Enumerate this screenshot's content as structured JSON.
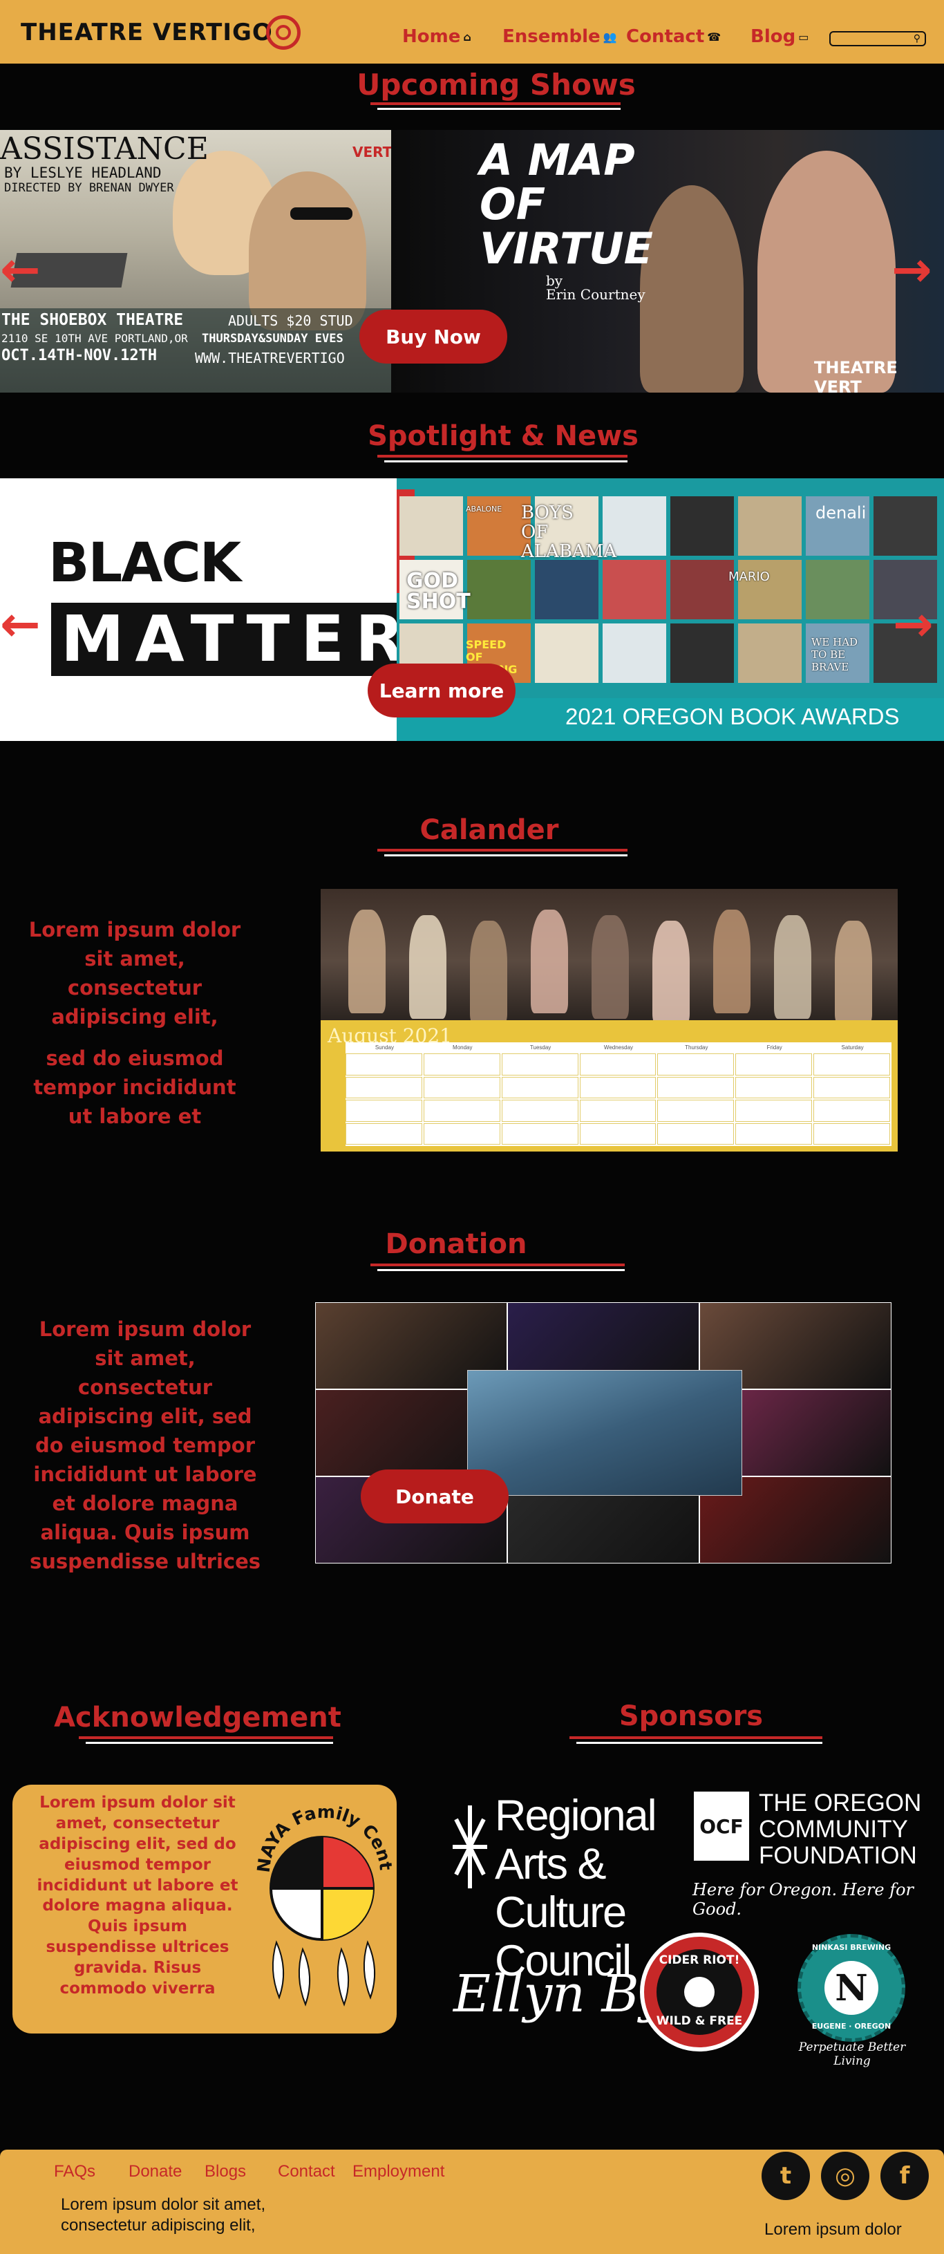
{
  "header": {
    "logo_text": "THEATRE VERTIGO",
    "nav": [
      {
        "label": "Home",
        "icon": "home-icon"
      },
      {
        "label": "Ensemble",
        "icon": "people-icon"
      },
      {
        "label": "Contact",
        "icon": "phone-icon"
      },
      {
        "label": "Blog",
        "icon": "laptop-icon"
      }
    ],
    "search": {
      "placeholder": ""
    }
  },
  "upcoming": {
    "title": "Upcoming Shows",
    "slide_left": {
      "title": "ASSISTANCE",
      "byline": "BY LESLYE HEADLAND",
      "director": "DIRECTED BY BRENAN DWYER",
      "venue": "THE SHOEBOX THEATRE",
      "prices": "ADULTS $20 STUD",
      "address": "2110 SE 10TH AVE PORTLAND,OR",
      "days": "THURSDAY&SUNDAY EVES",
      "dates": "OCT.14TH-NOV.12TH",
      "web": "WWW.THEATREVERTIGO",
      "corner": "VERTI"
    },
    "slide_right": {
      "title_line1": "A MAP",
      "title_line2": "OF",
      "title_line3": "VIRTUE",
      "by": "by",
      "author": "Erin Courtney",
      "brand": "THEATRE VERT"
    },
    "button": "Buy Now"
  },
  "spotlight": {
    "title": "Spotlight & News",
    "blm_line1": "BLACK LIVES",
    "blm_line2": "MATTER",
    "books_banner": "2021 OREGON BOOK AWARDS",
    "book_titles": [
      "ABALONE",
      "BOYS OF ALABAMA",
      "GOD SHOT",
      "SPEED OF FALLING",
      "MARIO",
      "denali",
      "WE HAD TO BE BRAVE"
    ],
    "button": "Learn more"
  },
  "calendar": {
    "title": "Calander",
    "text1": "Lorem ipsum dolor sit amet, consectetur adipiscing elit,",
    "text2": "sed do eiusmod tempor incididunt ut labore et",
    "month": "August 2021",
    "days": [
      "Sunday",
      "Monday",
      "Tuesday",
      "Wednesday",
      "Thursday",
      "Friday",
      "Saturday"
    ]
  },
  "donation": {
    "title": "Donation",
    "text": "Lorem ipsum dolor sit amet, consectetur adipiscing elit, sed do eiusmod tempor incididunt ut labore et dolore magna aliqua. Quis ipsum suspendisse ultrices",
    "button": "Donate"
  },
  "acknowledgement": {
    "title": "Acknowledgement",
    "text": "Lorem ipsum dolor sit amet, consectetur adipiscing elit, sed do eiusmod tempor incididunt ut labore et dolore magna aliqua. Quis ipsum suspendisse ultrices gravida. Risus commodo viverra",
    "logo_text": "NAYA Family Center"
  },
  "sponsors": {
    "title": "Sponsors",
    "racc": "Regional Arts & Culture Council",
    "ocf_line1": "THE OREGON",
    "ocf_line2": "COMMUNITY",
    "ocf_line3": "FOUNDATION",
    "ocf_tag": "Here for Oregon. Here for Good.",
    "ocf_mark": "OCF",
    "ellyn": "Ellyn Bye",
    "cider_top": "CIDER RIOT!",
    "cider_bottom": "WILD & FREE",
    "ninkasi": "NINKASI BREWING",
    "ninkasi_sub": "EUGENE · OREGON",
    "ninkasi_tag": "Perpetuate Better Living"
  },
  "footer": {
    "links": [
      "FAQs",
      "Donate",
      "Blogs",
      "Contact",
      "Employment"
    ],
    "text1": "Lorem ipsum dolor sit amet,",
    "text2": "consectetur adipiscing elit,",
    "right_text": "Lorem ipsum dolor",
    "social": [
      {
        "icon": "twitter-icon",
        "glyph": "t"
      },
      {
        "icon": "instagram-icon",
        "glyph": "◎"
      },
      {
        "icon": "facebook-icon",
        "glyph": "f"
      }
    ]
  }
}
